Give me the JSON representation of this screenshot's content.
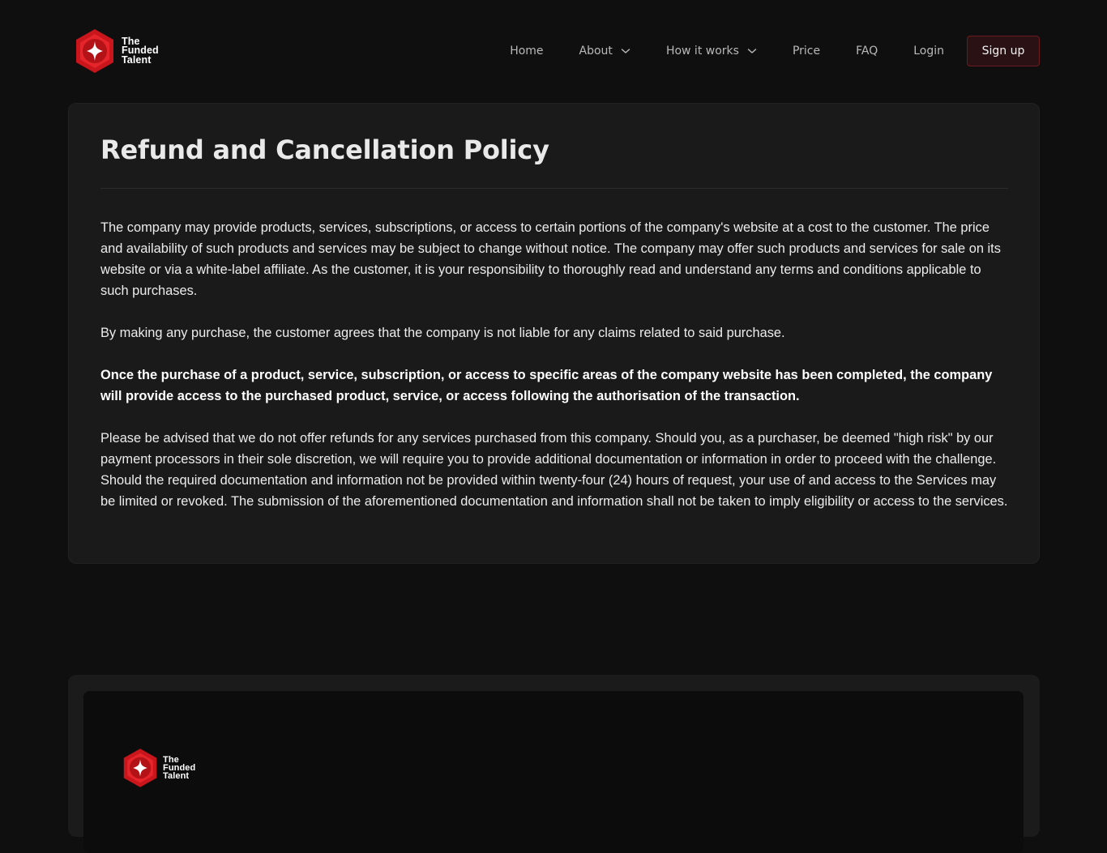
{
  "brand": {
    "lines": [
      "The",
      "Funded",
      "Talent"
    ],
    "accent_color": "#e0262b"
  },
  "nav": {
    "home": "Home",
    "about": "About",
    "how_it_works": "How it works",
    "price": "Price",
    "faq": "FAQ",
    "login": "Login",
    "signup": "Sign up"
  },
  "policy": {
    "title": "Refund and Cancellation Policy",
    "paragraphs": [
      "The company may provide products, services, subscriptions, or access to certain portions of the company's website at a cost to the customer. The price and availability of such products and services may be subject to change without notice. The company may offer such products and services for sale on its website or via a white-label affiliate. As the customer, it is your responsibility to thoroughly read and understand any terms and conditions applicable to such purchases.",
      "By making any purchase, the customer agrees that the company is not liable for any claims related to said purchase.",
      "Once the purchase of a product, service, subscription, or access to specific areas of the company website has been completed, the company will provide access to the purchased product, service, or access following the authorisation of the transaction.",
      "Please be advised that we do not offer refunds for any services purchased from this company. Should you, as a purchaser, be deemed \"high risk\" by our payment processors in their sole discretion, we will require you to provide additional documentation or information in order to proceed with the challenge. Should the required documentation and information not be provided within twenty-four (24) hours of request, your use of and access to the Services may be limited or revoked. The submission of the aforementioned documentation and information shall not be taken to imply eligibility or access to the services."
    ]
  },
  "footer": {
    "brand_lines": [
      "The",
      "Funded",
      "Talent"
    ]
  }
}
